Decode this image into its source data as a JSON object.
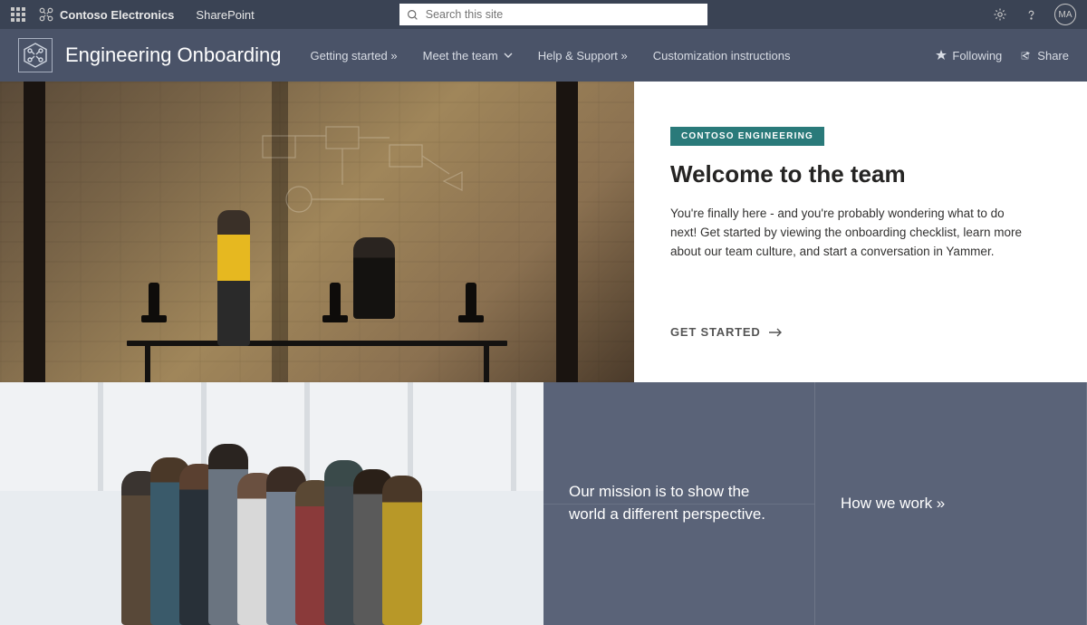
{
  "suite": {
    "brand": "Contoso Electronics",
    "app": "SharePoint",
    "search_placeholder": "Search this site",
    "avatar_initials": "MA"
  },
  "site": {
    "title": "Engineering Onboarding",
    "nav": [
      {
        "label": "Getting started »"
      },
      {
        "label": "Meet the team"
      },
      {
        "label": "Help & Support »"
      },
      {
        "label": "Customization instructions"
      }
    ],
    "actions": {
      "following": "Following",
      "share": "Share"
    }
  },
  "hero": {
    "tag": "CONTOSO ENGINEERING",
    "title": "Welcome to the team",
    "body": "You're finally here - and you're probably wondering what to do next! Get started by viewing the onboarding checklist, learn more about our team culture, and start a conversation in Yammer.",
    "cta": "GET STARTED"
  },
  "tiles": {
    "mission": "Our mission is to show the world a different perspective.",
    "how_we_work": "How we work »"
  }
}
